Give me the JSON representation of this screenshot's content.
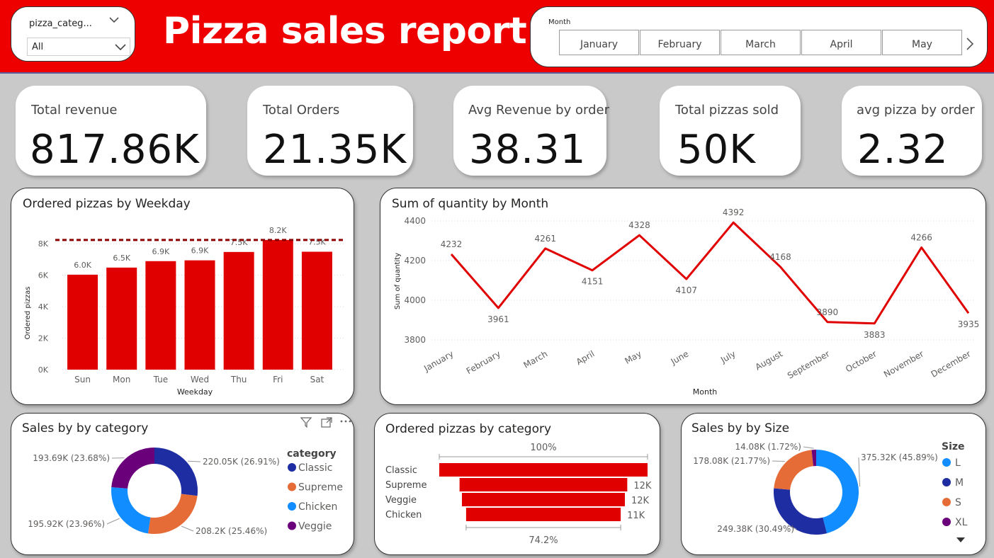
{
  "header": {
    "title": "Pizza sales report",
    "category_slicer": {
      "title": "pizza_categ...",
      "value": "All"
    },
    "month_slicer": {
      "title": "Month",
      "tiles": [
        "January",
        "February",
        "March",
        "April",
        "May"
      ]
    }
  },
  "kpis": [
    {
      "label": "Total revenue",
      "value": "817.86K"
    },
    {
      "label": "Total Orders",
      "value": "21.35K"
    },
    {
      "label": "Avg Revenue by order",
      "value": "38.31"
    },
    {
      "label": "Total pizzas sold",
      "value": "50K"
    },
    {
      "label": "avg pizza by order",
      "value": "2.32"
    }
  ],
  "colors": {
    "accent": "#ee0000",
    "chart_red": "#e00000",
    "avg_line": "#8b0000",
    "classic": "#1f2da3",
    "supreme": "#e66c37",
    "chicken": "#118dff",
    "veggie": "#6b007b"
  },
  "chart_data": [
    {
      "type": "bar",
      "title": "Ordered pizzas by Weekday",
      "xlabel": "Weekday",
      "ylabel": "Ordered pizzas",
      "categories": [
        "Sun",
        "Mon",
        "Tue",
        "Wed",
        "Thu",
        "Fri",
        "Sat"
      ],
      "values": [
        6035,
        6485,
        6895,
        6946,
        7478,
        8242,
        7493
      ],
      "data_labels": [
        "6.0K",
        "6.5K",
        "6.9K",
        "6.9K",
        "7.5K",
        "8.2K",
        "7.5K"
      ],
      "ylim": [
        0,
        9000
      ],
      "yticks": [
        "0K",
        "2K",
        "4K",
        "6K",
        "8K"
      ],
      "max_line": 8242,
      "grid": true
    },
    {
      "type": "line",
      "title": "Sum of quantity by Month",
      "xlabel": "Month",
      "ylabel": "Sum of quantity",
      "categories": [
        "January",
        "February",
        "March",
        "April",
        "May",
        "June",
        "July",
        "August",
        "September",
        "October",
        "November",
        "December"
      ],
      "values": [
        4232,
        3961,
        4261,
        4151,
        4328,
        4107,
        4392,
        4168,
        3890,
        3883,
        4266,
        3935
      ],
      "ylim": [
        3800,
        4400
      ],
      "yticks": [
        "3800",
        "4000",
        "4200",
        "4400"
      ],
      "grid": true
    },
    {
      "type": "pie",
      "title": "Sales by by category",
      "legend_title": "category",
      "legend_position": "right",
      "slices": [
        {
          "name": "Classic",
          "value": 220053,
          "label": "220.05K (26.91%)",
          "color": "#1f2da3"
        },
        {
          "name": "Supreme",
          "value": 208197,
          "label": "208.2K (25.46%)",
          "color": "#e66c37"
        },
        {
          "name": "Chicken",
          "value": 195920,
          "label": "195.92K (23.96%)",
          "color": "#118dff"
        },
        {
          "name": "Veggie",
          "value": 193690,
          "label": "193.69K (23.68%)",
          "color": "#6b007b"
        }
      ]
    },
    {
      "type": "bar",
      "title": "Ordered pizzas by category",
      "orientation": "funnel",
      "categories": [
        "Classic",
        "Supreme",
        "Veggie",
        "Chicken"
      ],
      "values": [
        14888,
        11987,
        11649,
        11050
      ],
      "data_labels": [
        "",
        "12K",
        "12K",
        "11K"
      ],
      "top_label": "100%",
      "bottom_label": "74.2%"
    },
    {
      "type": "pie",
      "title": "Sales by by Size",
      "legend_title": "Size",
      "legend_position": "right",
      "slices": [
        {
          "name": "L",
          "value": 375320,
          "label": "375.32K (45.89%)",
          "color": "#118dff"
        },
        {
          "name": "M",
          "value": 249380,
          "label": "249.38K (30.49%)",
          "color": "#1f2da3"
        },
        {
          "name": "S",
          "value": 178080,
          "label": "178.08K (21.77%)",
          "color": "#e66c37"
        },
        {
          "name": "XL",
          "value": 14080,
          "label": "14.08K (1.72%)",
          "color": "#6b007b"
        }
      ]
    }
  ]
}
